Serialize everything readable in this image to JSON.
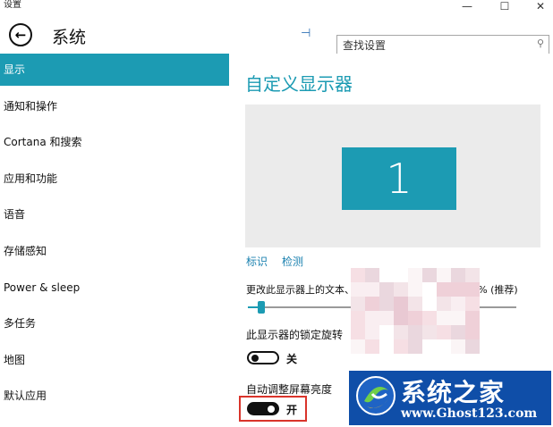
{
  "window": {
    "title": "设置",
    "minimize_glyph": "—",
    "maximize_glyph": "☐",
    "close_glyph": "✕"
  },
  "header": {
    "back_glyph": "←",
    "title": "系统",
    "pin_glyph": "⊣",
    "search": {
      "value": "查找设置",
      "icon": "search-icon",
      "icon_glyph": "⚲"
    }
  },
  "sidebar": {
    "items": [
      {
        "label": "显示",
        "active": true
      },
      {
        "label": "通知和操作",
        "active": false
      },
      {
        "label": "Cortana 和搜索",
        "active": false
      },
      {
        "label": "应用和功能",
        "active": false
      },
      {
        "label": "语音",
        "active": false
      },
      {
        "label": "存储感知",
        "active": false
      },
      {
        "label": "Power & sleep",
        "active": false
      },
      {
        "label": "多任务",
        "active": false
      },
      {
        "label": "地图",
        "active": false
      },
      {
        "label": "默认应用",
        "active": false
      }
    ]
  },
  "main": {
    "title": "自定义显示器",
    "monitor_number": "1",
    "identify_link": "标识",
    "detect_link": "检测",
    "scale_label": "更改此显示器上的文本、应用和其他项目的大小: 100% (推荐)",
    "scale_slider_fraction": 0.05,
    "lock_rotation_label": "此显示器的锁定旋转",
    "lock_rotation_state": "关",
    "auto_brightness_label": "自动调整屏幕亮度",
    "auto_brightness_state": "开"
  },
  "watermark": {
    "title": "系统之家",
    "url": "www.Ghost123.com"
  },
  "colors": {
    "accent": "#1c9bb3",
    "link": "#1c82b0",
    "highlight": "#d9342b",
    "watermark_bg": "#0f4ea8"
  }
}
